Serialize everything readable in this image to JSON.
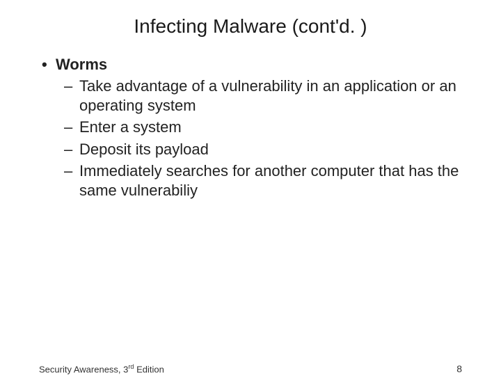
{
  "title": "Infecting Malware (cont'd. )",
  "bullet": "Worms",
  "sub": [
    "Take advantage of a vulnerability in an application or an operating system",
    "Enter a system",
    "Deposit its payload",
    "Immediately searches for another computer that has the same vulnerabiliy"
  ],
  "footer": {
    "text_before": "Security Awareness, 3",
    "sup": "rd",
    "text_after": " Edition",
    "page": "8"
  }
}
